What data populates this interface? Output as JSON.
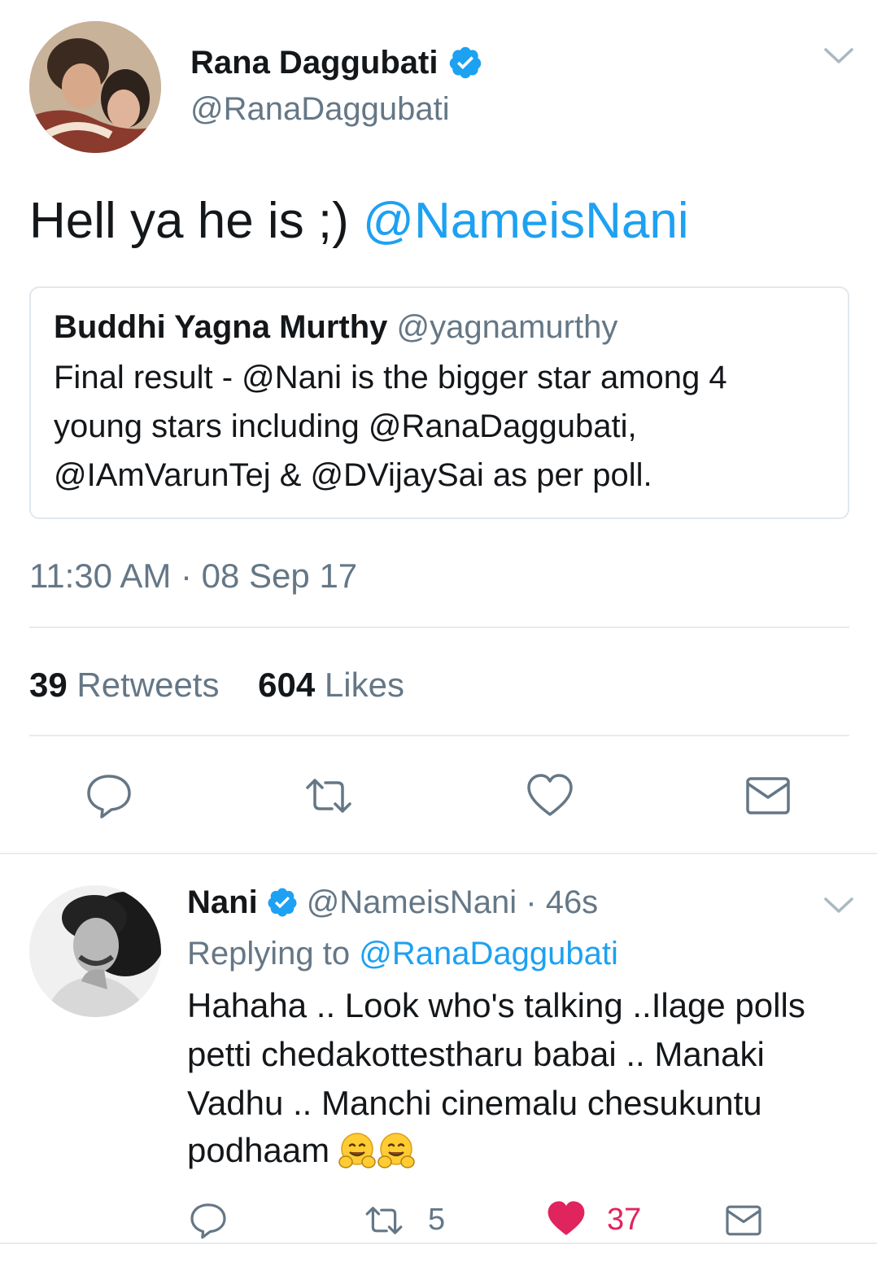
{
  "main_tweet": {
    "author_name": "Rana Daggubati",
    "author_handle": "@RanaDaggubati",
    "text_plain": "Hell ya he is ;) ",
    "text_mention": "@NameisNani",
    "quoted_tweet": {
      "author_name": "Buddhi Yagna Murthy",
      "author_handle": "@yagnamurthy",
      "line1": "Final result - @Nani is the bigger star among 4",
      "line2": "young stars including @RanaDaggubati,",
      "line3": "@IAmVarunTej & @DVijaySai as per poll."
    },
    "timestamp": "11:30 AM · 08 Sep 17",
    "retweets_count": "39",
    "retweets_label": "Retweets",
    "likes_count": "604",
    "likes_label": "Likes",
    "actions": [
      "reply-icon",
      "retweet-icon",
      "like-icon",
      "direct-message-icon"
    ]
  },
  "reply_tweet": {
    "author_name": "Nani",
    "meta": "@NameisNani · 46s",
    "replying_to_label": "Replying to ",
    "replying_to_handle": "@RanaDaggubati",
    "line1": "Hahaha .. Look who's talking ..Ilage polls",
    "line2": "petti chedakottestharu babai .. Manaki",
    "line3": "Vadhu .. Manchi cinemalu chesukuntu",
    "line4": "podhaam",
    "emoji": [
      "hugging-face-emoji",
      "hugging-face-emoji"
    ],
    "retweet_count": "5",
    "like_count": "37",
    "liked": true
  },
  "colors": {
    "accent_blue": "#1da1f2",
    "muted_text": "#657786",
    "like_red": "#e0245e",
    "border": "#e1e8ed"
  }
}
